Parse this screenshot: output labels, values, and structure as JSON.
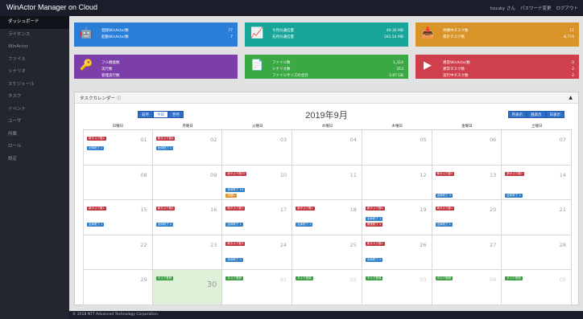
{
  "app": {
    "title": "WinActor Manager on Cloud",
    "user": "tsuuky さん",
    "password_change": "パスワード変更",
    "logout": "ログアウト"
  },
  "sidebar": {
    "items": [
      "ダッシュボード",
      "ライセンス",
      "WinActor",
      "ファイル",
      "シナリオ",
      "スケジュール",
      "タスク",
      "イベント",
      "ユーザ",
      "所属",
      "ロール",
      "設定"
    ]
  },
  "cards": {
    "c1": {
      "icon": "robot-icon",
      "color": "#2a7ed8",
      "rows": [
        {
          "label": "登録WinActor数",
          "value": "77"
        },
        {
          "label": "起動WinActor数",
          "value": "7"
        }
      ]
    },
    "c2": {
      "icon": "chart-icon",
      "color": "#18a59a",
      "rows": [
        {
          "label": "今月の通信量",
          "value": "49.36 MB"
        },
        {
          "label": "先月の通信量",
          "value": "161.54 MB"
        }
      ]
    },
    "c3": {
      "icon": "inbox-icon",
      "color": "#d99428",
      "rows": [
        {
          "label": "待機中タスク数",
          "value": "11"
        },
        {
          "label": "累計タスク数",
          "value": "8,774"
        }
      ]
    },
    "c4": {
      "icon": "key-icon",
      "color": "#7c3ea8",
      "rows": [
        {
          "label": "フル機能数",
          "value": ""
        },
        {
          "label": "実行数",
          "value": ""
        },
        {
          "label": "管理実行数",
          "value": ""
        }
      ]
    },
    "c5": {
      "icon": "file-icon",
      "color": "#3aa843",
      "rows": [
        {
          "label": "ファイル数",
          "value": "1,314"
        },
        {
          "label": "シナリオ数",
          "value": "353"
        },
        {
          "label": "ファイルサイズの合計",
          "value": "3.87 GB"
        }
      ]
    },
    "c6": {
      "icon": "play-icon",
      "color": "#d0404c",
      "rows": [
        {
          "label": "異常WinActor数",
          "value": "0"
        },
        {
          "label": "異常タスク数",
          "value": "2"
        },
        {
          "label": "実行中タスク数",
          "value": "2"
        }
      ]
    }
  },
  "calendar": {
    "panel_title": "タスクカレンダー",
    "title": "2019年9月",
    "nav": {
      "prev": "前月",
      "today": "今日",
      "next": "翌月"
    },
    "views": {
      "month": "月表示",
      "week": "週表示",
      "day": "日表示"
    },
    "weekdays": [
      "日曜日",
      "月曜日",
      "火曜日",
      "水曜日",
      "木曜日",
      "金曜日",
      "土曜日"
    ],
    "days": [
      {
        "n": "01",
        "ev": [
          {
            "t": "新タスク数2",
            "c": "red"
          },
          {
            "t": "全体終了 1",
            "c": "blue",
            "y": 20
          }
        ]
      },
      {
        "n": "02",
        "ev": [
          {
            "t": "新タスク数4",
            "c": "red"
          },
          {
            "t": "全体終了 1",
            "c": "blue",
            "y": 20
          }
        ]
      },
      {
        "n": "03",
        "ev": []
      },
      {
        "n": "04",
        "ev": []
      },
      {
        "n": "05",
        "ev": []
      },
      {
        "n": "06",
        "ev": []
      },
      {
        "n": "07",
        "ev": []
      },
      {
        "n": "08",
        "ev": []
      },
      {
        "n": "09",
        "ev": []
      },
      {
        "n": "10",
        "ev": [
          {
            "t": "新タスク数22",
            "c": "red"
          },
          {
            "t": "全体終了 14",
            "c": "blue",
            "y": 28
          },
          {
            "t": "待機1",
            "c": "orange",
            "y": 35
          }
        ]
      },
      {
        "n": "11",
        "ev": []
      },
      {
        "n": "12",
        "ev": []
      },
      {
        "n": "13",
        "ev": [
          {
            "t": "新タスク数3",
            "c": "red"
          },
          {
            "t": "全体終了 3",
            "c": "blue",
            "y": 35
          }
        ]
      },
      {
        "n": "14",
        "ev": [
          {
            "t": "新タスク数1",
            "c": "red"
          },
          {
            "t": "全体終了 1",
            "c": "blue",
            "y": 35
          }
        ]
      },
      {
        "n": "15",
        "ev": [
          {
            "t": "新タスク数1",
            "c": "red"
          },
          {
            "t": "全体終了 1",
            "c": "blue",
            "y": 28
          }
        ]
      },
      {
        "n": "16",
        "ev": [
          {
            "t": "新タスク数2",
            "c": "red"
          },
          {
            "t": "全体終了 2",
            "c": "blue",
            "y": 28
          }
        ]
      },
      {
        "n": "17",
        "ev": [
          {
            "t": "新タスク数1",
            "c": "red"
          },
          {
            "t": "全体終了 1",
            "c": "blue",
            "y": 28
          }
        ]
      },
      {
        "n": "18",
        "ev": [
          {
            "t": "新タスク数1",
            "c": "red"
          },
          {
            "t": "全体終了 1",
            "c": "blue",
            "y": 28
          }
        ]
      },
      {
        "n": "19",
        "ev": [
          {
            "t": "新タスク数6",
            "c": "red"
          },
          {
            "t": "全体終了 1",
            "c": "blue",
            "y": 21
          },
          {
            "t": "異常終了 5",
            "c": "red",
            "y": 28
          }
        ]
      },
      {
        "n": "20",
        "ev": [
          {
            "t": "新タスク数1",
            "c": "red"
          },
          {
            "t": "全体終了 1",
            "c": "blue",
            "y": 28
          }
        ]
      },
      {
        "n": "21",
        "ev": []
      },
      {
        "n": "22",
        "ev": []
      },
      {
        "n": "23",
        "ev": []
      },
      {
        "n": "24",
        "ev": [
          {
            "t": "新タスク数3",
            "c": "red"
          },
          {
            "t": "全体終了 3",
            "c": "blue",
            "y": 28
          }
        ]
      },
      {
        "n": "25",
        "ev": []
      },
      {
        "n": "26",
        "ev": [
          {
            "t": "新タスク数2",
            "c": "red"
          },
          {
            "t": "全体終了 2",
            "c": "blue",
            "y": 28
          }
        ]
      },
      {
        "n": "27",
        "ev": []
      },
      {
        "n": "28",
        "ev": []
      },
      {
        "n": "29",
        "ev": []
      },
      {
        "n": "30",
        "today": true,
        "ev": [
          {
            "t": "タスク登録",
            "c": "green"
          }
        ]
      },
      {
        "n": "01",
        "dim": true,
        "ev": [
          {
            "t": "タスク登録",
            "c": "green"
          }
        ]
      },
      {
        "n": "02",
        "dim": true,
        "ev": [
          {
            "t": "タスク登録",
            "c": "green"
          }
        ]
      },
      {
        "n": "03",
        "dim": true,
        "ev": [
          {
            "t": "タスク登録",
            "c": "green"
          }
        ]
      },
      {
        "n": "04",
        "dim": true,
        "ev": [
          {
            "t": "タスク登録",
            "c": "green"
          }
        ]
      },
      {
        "n": "05",
        "dim": true,
        "ev": [
          {
            "t": "タスク登録",
            "c": "green"
          }
        ]
      }
    ]
  },
  "footer": "© 2018 NTT Advanced Technology Corporation."
}
